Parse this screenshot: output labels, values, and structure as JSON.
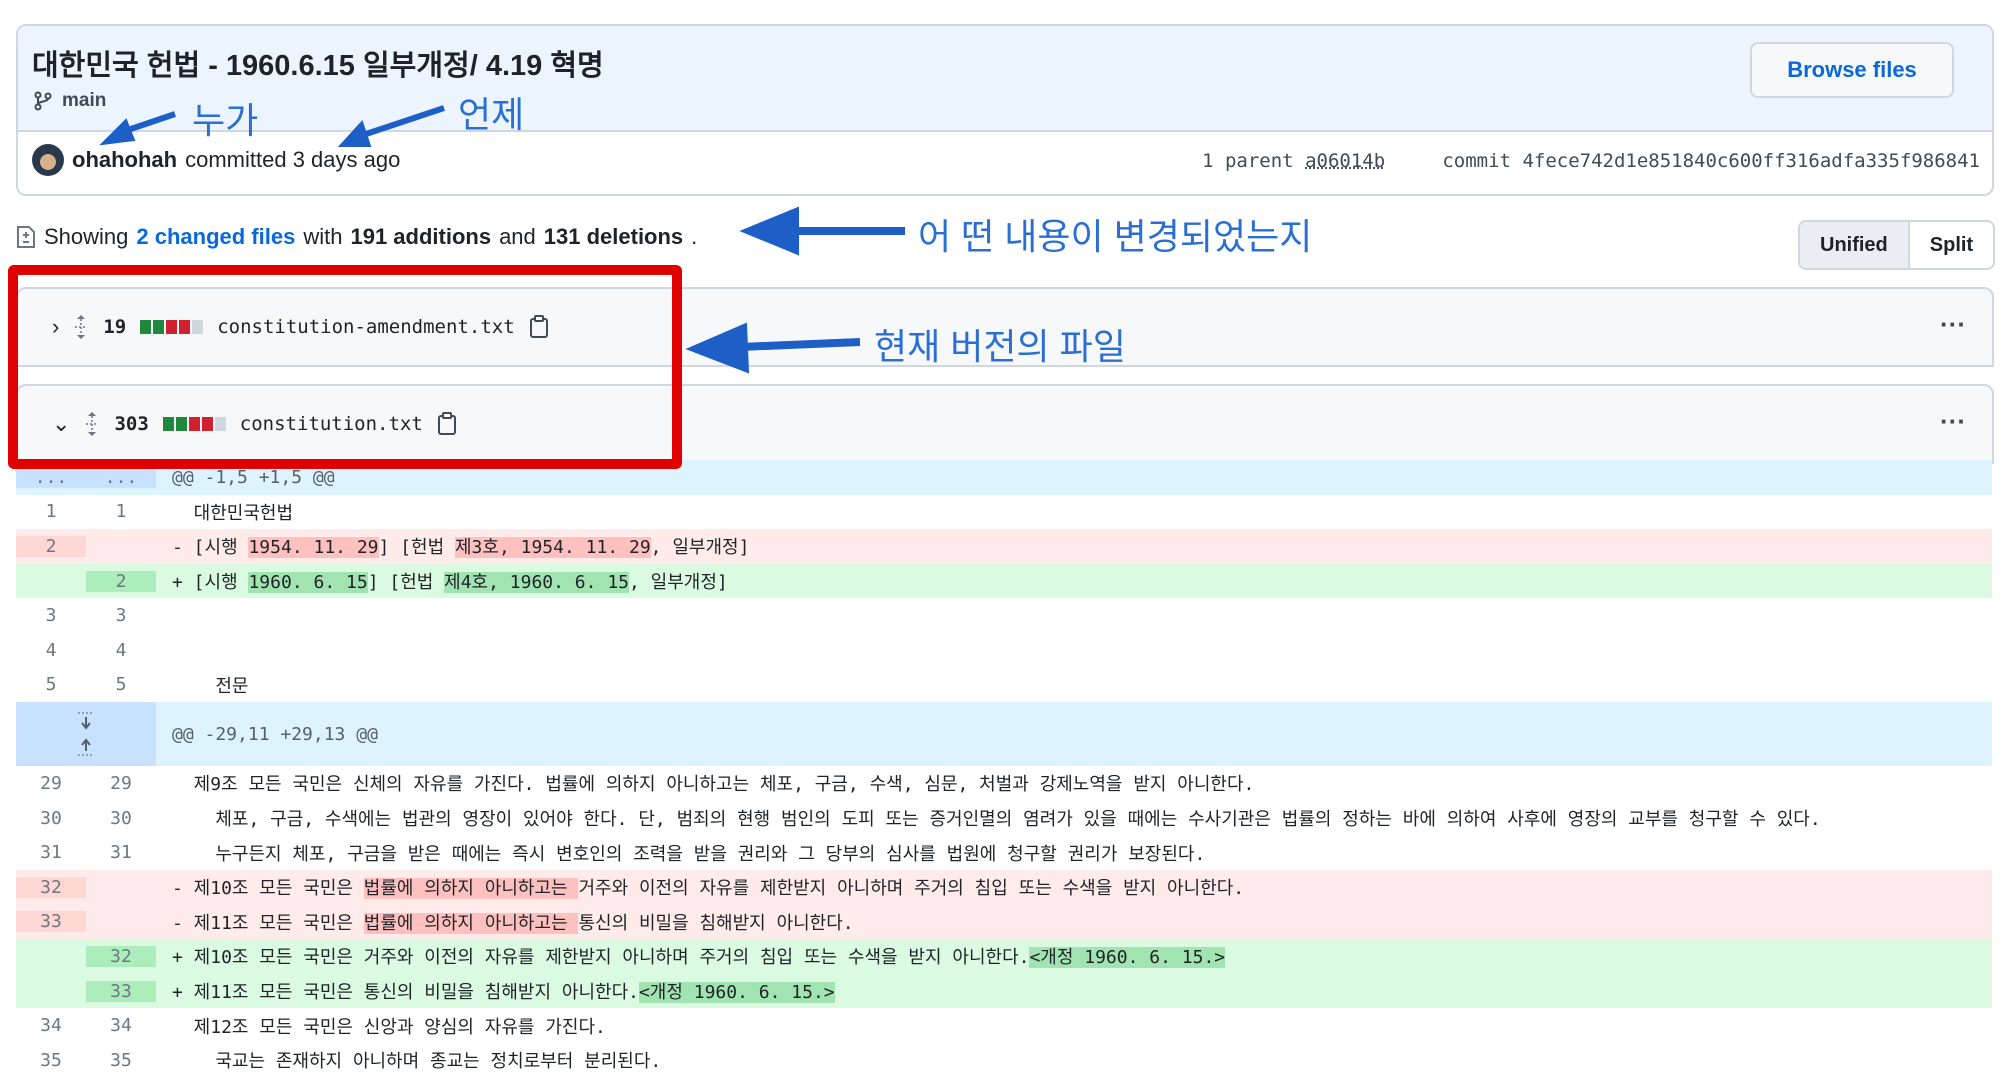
{
  "commit": {
    "title": "대한민국 헌법 - 1960.6.15 일부개정/ 4.19 혁명",
    "branch": "main",
    "browse_files": "Browse files",
    "author": "ohahohah",
    "committed_text": "committed 3 days ago",
    "parent_label": "1 parent",
    "parent_sha": "a06014b",
    "commit_label": "commit",
    "commit_sha": "4fece742d1e851840c600ff316adfa335f986841"
  },
  "summary": {
    "prefix": "Showing",
    "changed_files": "2 changed files",
    "with": "with",
    "additions": "191 additions",
    "and": "and",
    "deletions": "131 deletions",
    "end": "."
  },
  "view_toggle": {
    "unified": "Unified",
    "split": "Split"
  },
  "files": [
    {
      "count": "19",
      "name": "constitution-amendment.txt"
    },
    {
      "count": "303",
      "name": "constitution.txt"
    }
  ],
  "diff": {
    "hunk1": "@@ -1,5 +1,5 @@",
    "hunk1_ln": "...",
    "hunk2": "@@ -29,11 +29,13 @@",
    "l1": "  대한민국헌법",
    "d2a": "- [시행 ",
    "d2b": "1954. 11. 29",
    "d2c": "] [헌법 ",
    "d2d": "제3호, 1954. 11. 29",
    "d2e": ", 일부개정]",
    "a2a": "+ [시행 ",
    "a2b": "1960. 6. 15",
    "a2c": "] [헌법 ",
    "a2d": "제4호, 1960. 6. 15",
    "a2e": ", 일부개정]",
    "l5": "    전문",
    "l29": "  제9조 모든 국민은 신체의 자유를 가진다. 법률에 의하지 아니하고는 체포, 구금, 수색, 심문, 처벌과 강제노역을 받지 아니한다.",
    "l30": "    체포, 구금, 수색에는 법관의 영장이 있어야 한다. 단, 범죄의 현행 범인의 도피 또는 증거인멸의 염려가 있을 때에는 수사기관은 법률의 정하는 바에 의하여 사후에 영장의 교부를 청구할 수 있다.",
    "l31": "    누구든지 체포, 구금을 받은 때에는 즉시 변호인의 조력을 받을 권리와 그 당부의 심사를 법원에 청구할 권리가 보장된다.",
    "d32a": "- 제10조 모든 국민은 ",
    "d32b": "법률에 의하지 아니하고는 ",
    "d32c": "거주와 이전의 자유를 제한받지 아니하며 주거의 침입 또는 수색을 받지 아니한다.",
    "d33a": "- 제11조 모든 국민은 ",
    "d33b": "법률에 의하지 아니하고는 ",
    "d33c": "통신의 비밀을 침해받지 아니한다.",
    "a32a": "+ 제10조 모든 국민은 거주와 이전의 자유를 제한받지 아니하며 주거의 침입 또는 수색을 받지 아니한다.",
    "a32b": "<개정 1960. 6. 15.>",
    "a33a": "+ 제11조 모든 국민은 통신의 비밀을 침해받지 아니한다.",
    "a33b": "<개정 1960. 6. 15.>",
    "l34": "  제12조 모든 국민은 신앙과 양심의 자유를 가진다.",
    "l35": "    국교는 존재하지 아니하며 종교는 정치로부터 분리된다.",
    "n1": "1",
    "n2": "2",
    "n3": "3",
    "n4": "4",
    "n5": "5",
    "n29": "29",
    "n30": "30",
    "n31": "31",
    "n32": "32",
    "n33": "33",
    "n34": "34",
    "n35": "35"
  },
  "annotations": {
    "who": "누가",
    "when": "언제",
    "what": "어 떤 내용이 변경되었는지",
    "current": "현재 버전의 파일"
  },
  "colors": {
    "annotation": "#2a6fd1",
    "red_box": "#e00000",
    "link": "#0969da"
  }
}
